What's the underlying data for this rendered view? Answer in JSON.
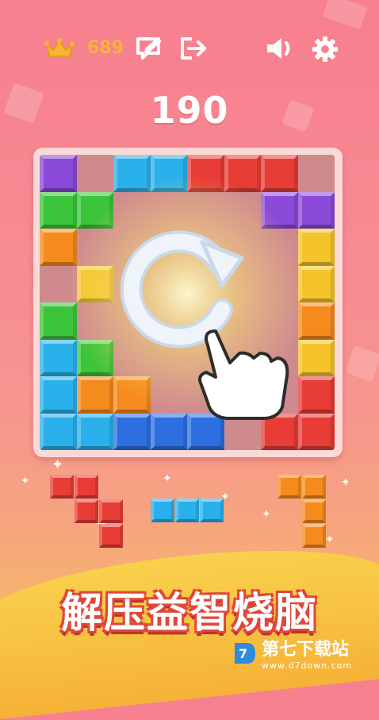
{
  "header": {
    "best_score": "689",
    "icons": [
      "crown-icon",
      "edit-icon",
      "exit-icon",
      "sound-icon",
      "settings-icon"
    ]
  },
  "score": "190",
  "board": {
    "rows": 8,
    "cols": 8,
    "cells": [
      [
        "purple",
        null,
        "cyan",
        "cyan",
        "red",
        "red",
        "red",
        null
      ],
      [
        "green",
        "green",
        null,
        null,
        null,
        null,
        "purple",
        "purple"
      ],
      [
        "orange",
        null,
        null,
        null,
        null,
        null,
        null,
        "yellow"
      ],
      [
        null,
        "yellow",
        null,
        null,
        null,
        null,
        null,
        "yellow"
      ],
      [
        "green",
        null,
        null,
        null,
        null,
        null,
        null,
        "orange"
      ],
      [
        "cyan",
        "green",
        null,
        null,
        null,
        null,
        null,
        "yellow"
      ],
      [
        "cyan",
        "orange",
        "orange",
        null,
        null,
        null,
        null,
        "red"
      ],
      [
        "cyan",
        "cyan",
        "blue",
        "blue",
        "blue",
        null,
        "red",
        "red"
      ]
    ]
  },
  "colors": {
    "purple": "#8a49d8",
    "cyan": "#2ab0ea",
    "red": "#e83c36",
    "green": "#3cc43a",
    "orange": "#f58a1d",
    "yellow": "#f5c42a",
    "blue": "#2d6fe0"
  },
  "tray": [
    {
      "color": "red",
      "cells": [
        [
          0,
          0
        ],
        [
          0,
          1
        ],
        [
          1,
          1
        ],
        [
          1,
          2
        ],
        [
          2,
          2
        ]
      ]
    },
    {
      "color": "cyan",
      "cells": [
        [
          0,
          0
        ],
        [
          0,
          1
        ],
        [
          0,
          2
        ]
      ]
    },
    {
      "color": "orange",
      "cells": [
        [
          0,
          0
        ],
        [
          0,
          1
        ],
        [
          1,
          1
        ],
        [
          2,
          1
        ]
      ]
    }
  ],
  "banner": "解压益智烧脑",
  "watermark": {
    "title": "第七下载站",
    "url": "www.d7down.com"
  }
}
